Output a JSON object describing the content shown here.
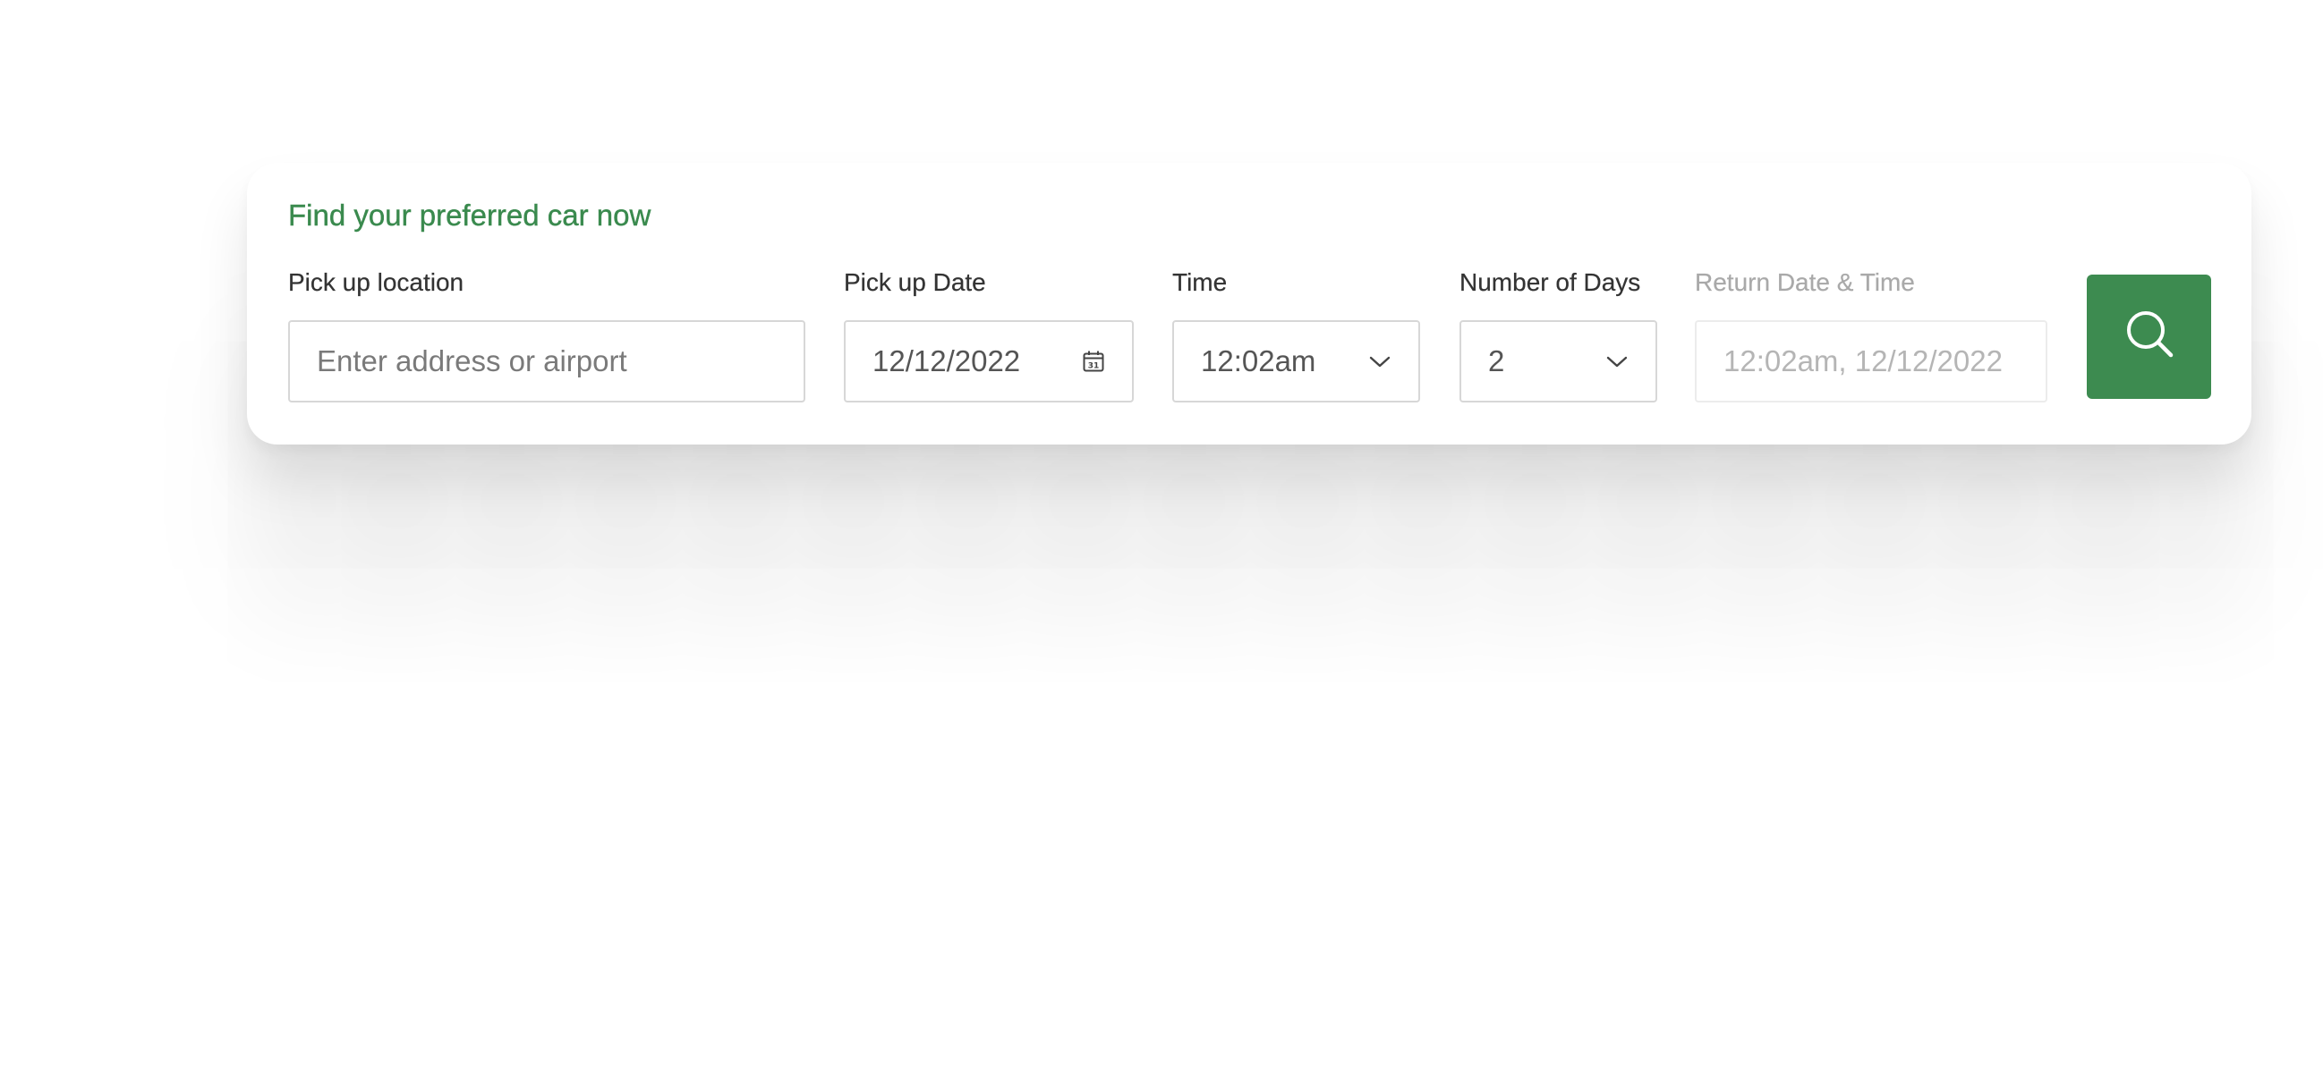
{
  "card": {
    "title": "Find your preferred car now"
  },
  "fields": {
    "pickup_location": {
      "label": "Pick up location",
      "placeholder": "Enter address or airport",
      "value": ""
    },
    "pickup_date": {
      "label": "Pick up Date",
      "value": "12/12/2022",
      "icon": "calendar-icon"
    },
    "time": {
      "label": "Time",
      "value": "12:02am",
      "icon": "chevron-down-icon"
    },
    "number_of_days": {
      "label": "Number of Days",
      "value": "2",
      "icon": "chevron-down-icon"
    },
    "return_date_time": {
      "label": "Return Date & Time",
      "value": "12:02am, 12/12/2022"
    }
  },
  "search_button": {
    "icon": "search-icon"
  },
  "colors": {
    "accent": "#3d8b50",
    "title": "#3a8a4e",
    "label": "#333333",
    "muted": "#a9a9a9",
    "border": "#d7d7d7"
  }
}
